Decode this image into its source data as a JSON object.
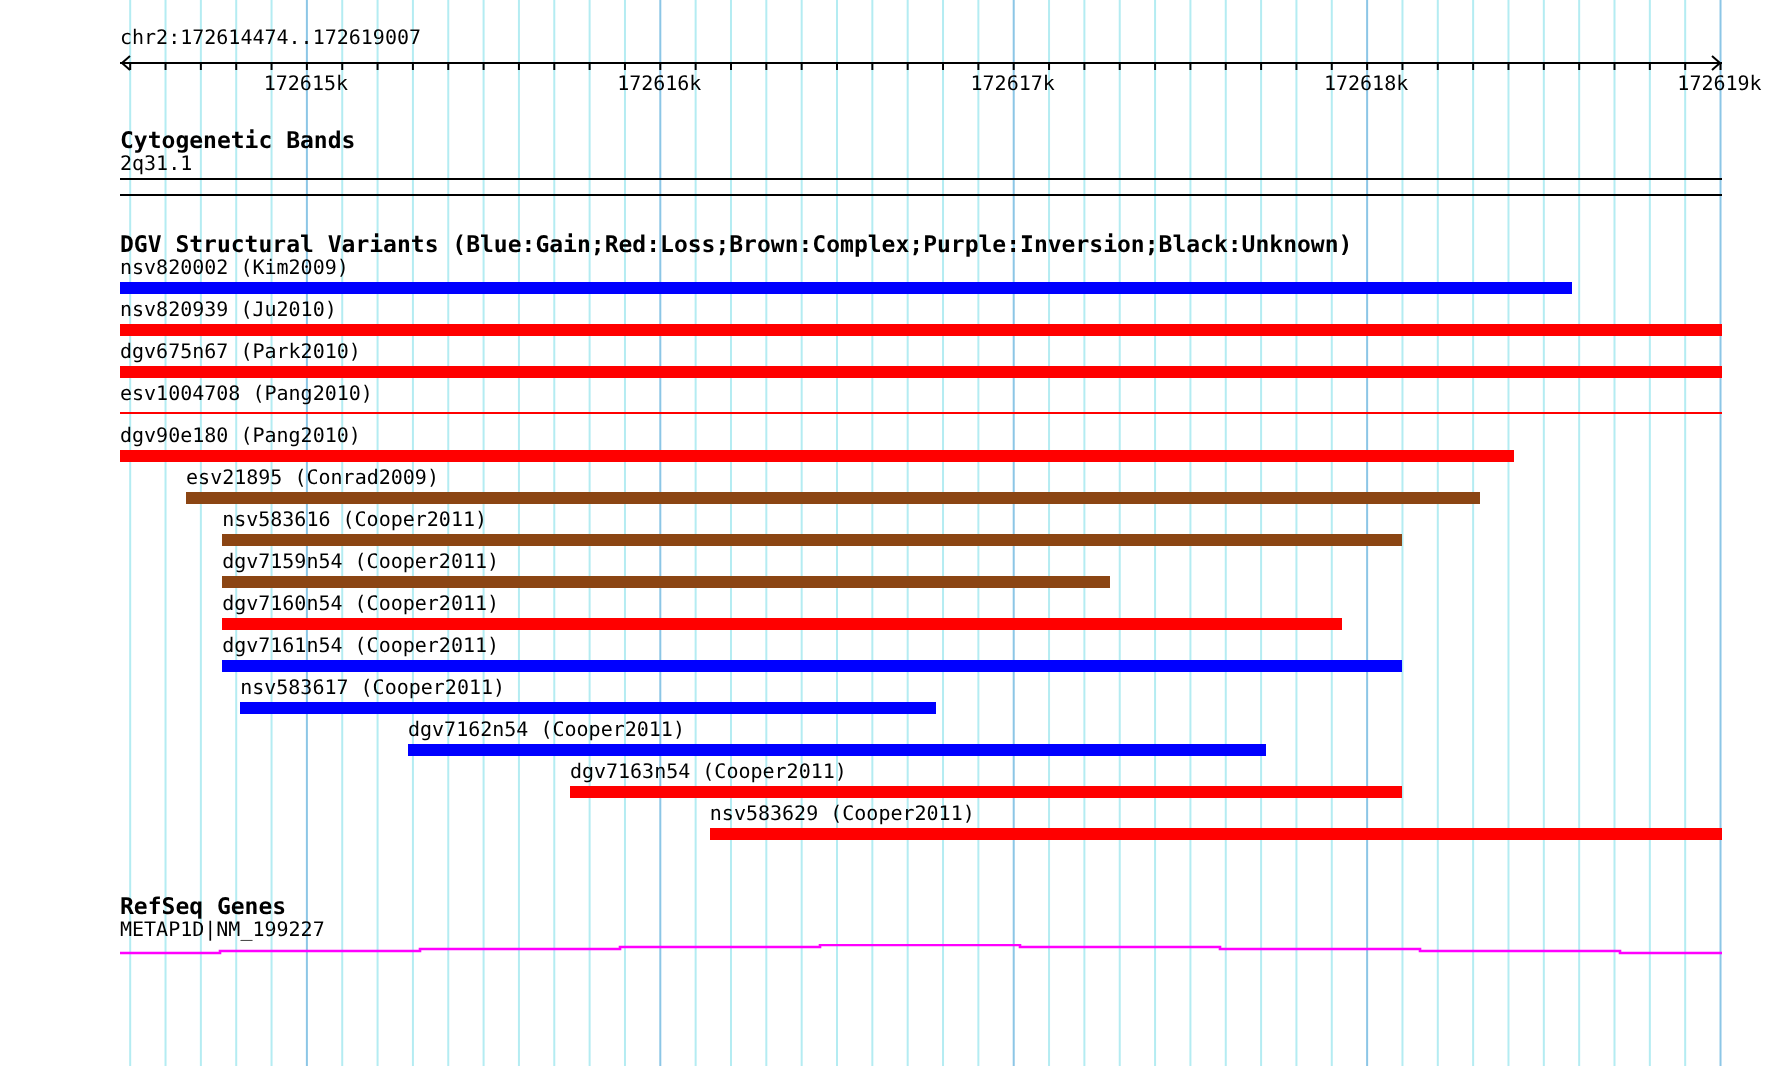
{
  "ruler": {
    "location": "chr2:172614474..172619007",
    "ticks": [
      {
        "label": "172615k"
      },
      {
        "label": "172616k"
      },
      {
        "label": "172617k"
      },
      {
        "label": "172618k"
      },
      {
        "label": "172619k"
      }
    ]
  },
  "cytogenetic_bands": {
    "title": "Cytogenetic Bands",
    "band": "2q31.1"
  },
  "dgv": {
    "title": "DGV Structural Variants (Blue:Gain;Red:Loss;Brown:Complex;Purple:Inversion;Black:Unknown)",
    "variants": [
      {
        "label": "nsv820002 (Kim2009)",
        "color": "#0000ff",
        "kind": "bar"
      },
      {
        "label": "nsv820939 (Ju2010)",
        "color": "#ff0000",
        "kind": "bar"
      },
      {
        "label": "dgv675n67 (Park2010)",
        "color": "#ff0000",
        "kind": "bar"
      },
      {
        "label": "esv1004708 (Pang2010)",
        "color": "#ff0000",
        "kind": "line"
      },
      {
        "label": "dgv90e180 (Pang2010)",
        "color": "#ff0000",
        "kind": "bar"
      },
      {
        "label": "esv21895 (Conrad2009)",
        "color": "#8b4513",
        "kind": "bar"
      },
      {
        "label": "nsv583616 (Cooper2011)",
        "color": "#8b4513",
        "kind": "bar"
      },
      {
        "label": "dgv7159n54 (Cooper2011)",
        "color": "#8b4513",
        "kind": "bar"
      },
      {
        "label": "dgv7160n54 (Cooper2011)",
        "color": "#ff0000",
        "kind": "bar"
      },
      {
        "label": "dgv7161n54 (Cooper2011)",
        "color": "#0000ff",
        "kind": "bar"
      },
      {
        "label": "nsv583617 (Cooper2011)",
        "color": "#0000ff",
        "kind": "bar"
      },
      {
        "label": "dgv7162n54 (Cooper2011)",
        "color": "#0000ff",
        "kind": "bar"
      },
      {
        "label": "dgv7163n54 (Cooper2011)",
        "color": "#ff0000",
        "kind": "bar"
      },
      {
        "label": "nsv583629 (Cooper2011)",
        "color": "#ff0000",
        "kind": "bar"
      }
    ]
  },
  "refseq": {
    "title": "RefSeq Genes",
    "gene": "METAP1D|NM_199227"
  }
}
